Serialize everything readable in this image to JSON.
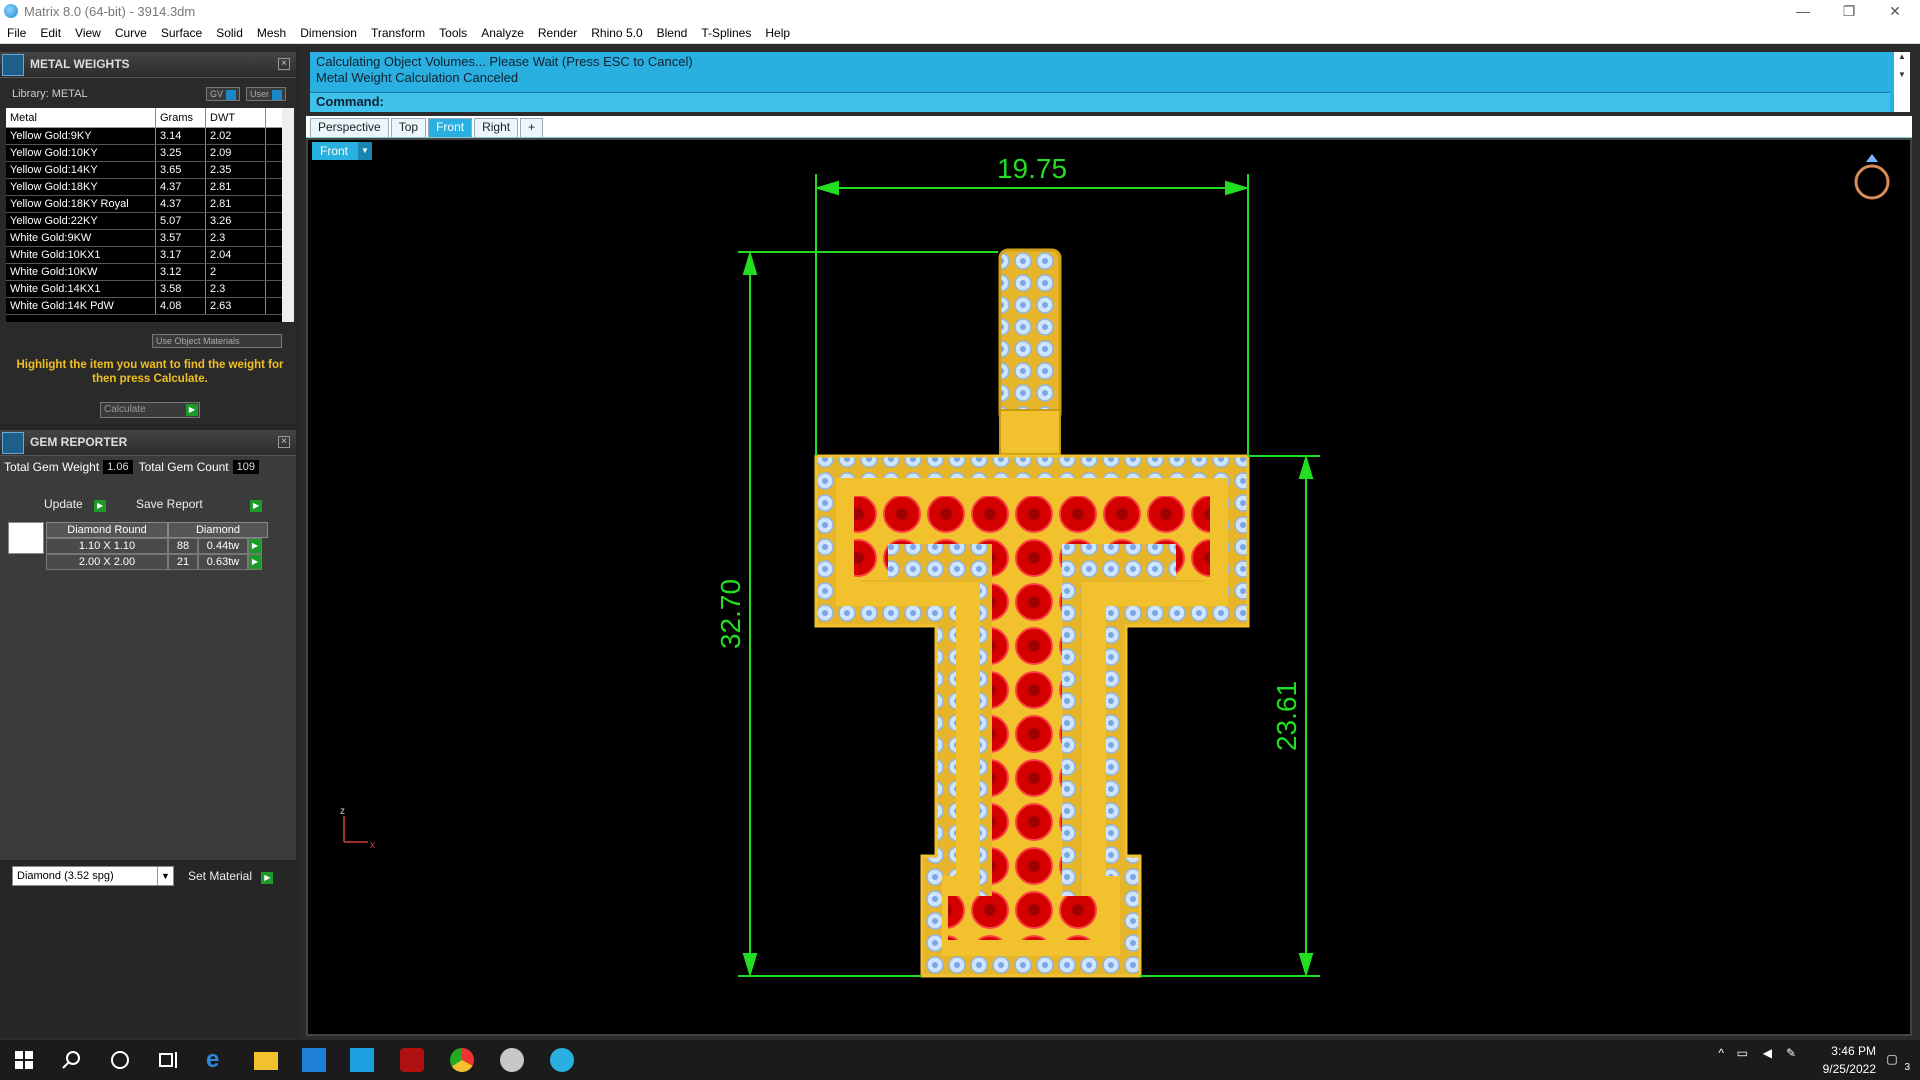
{
  "window": {
    "title": "Matrix 8.0 (64-bit) - 3914.3dm",
    "minimize": "—",
    "restore": "❐",
    "close": "✕"
  },
  "menu": [
    "File",
    "Edit",
    "View",
    "Curve",
    "Surface",
    "Solid",
    "Mesh",
    "Dimension",
    "Transform",
    "Tools",
    "Analyze",
    "Render",
    "Rhino 5.0",
    "Blend",
    "T-Splines",
    "Help"
  ],
  "metal_weights": {
    "title": "METAL WEIGHTS",
    "library_label": "Library: METAL",
    "gv_btn": "GV",
    "user_btn": "User",
    "columns": [
      "Metal",
      "Grams",
      "DWT"
    ],
    "rows": [
      [
        "Yellow Gold:9KY",
        "3.14",
        "2.02"
      ],
      [
        "Yellow Gold:10KY",
        "3.25",
        "2.09"
      ],
      [
        "Yellow Gold:14KY",
        "3.65",
        "2.35"
      ],
      [
        "Yellow Gold:18KY",
        "4.37",
        "2.81"
      ],
      [
        "Yellow Gold:18KY Royal",
        "4.37",
        "2.81"
      ],
      [
        "Yellow Gold:22KY",
        "5.07",
        "3.26"
      ],
      [
        "White Gold:9KW",
        "3.57",
        "2.3"
      ],
      [
        "White Gold:10KX1",
        "3.17",
        "2.04"
      ],
      [
        "White Gold:10KW",
        "3.12",
        "2"
      ],
      [
        "White Gold:14KX1",
        "3.58",
        "2.3"
      ],
      [
        "White Gold:14K PdW",
        "4.08",
        "2.63"
      ]
    ],
    "use_object_materials": "Use Object Materials",
    "hint": "Highlight the item you want to find the weight for then press Calculate.",
    "calculate": "Calculate"
  },
  "gem_reporter": {
    "title": "GEM REPORTER",
    "total_weight_label": "Total Gem Weight",
    "total_weight": "1.06",
    "total_count_label": "Total Gem Count",
    "total_count": "109",
    "update": "Update",
    "save_report": "Save Report",
    "gem_cut": "Diamond Round",
    "gem_type": "Diamond",
    "rows": [
      [
        "1.10 X 1.10",
        "88",
        "0.44tw"
      ],
      [
        "2.00 X 2.00",
        "21",
        "0.63tw"
      ]
    ],
    "material_select": "Diamond     (3.52 spg)",
    "set_material": "Set Material"
  },
  "command": {
    "line1": "Calculating Object Volumes... Please Wait (Press ESC to Cancel)",
    "line2": "Metal Weight Calculation Canceled",
    "prompt": "Command:"
  },
  "viewport_tabs": [
    "Perspective",
    "Top",
    "Front",
    "Right"
  ],
  "active_tab": "Front",
  "viewport_label": "Front",
  "dimensions": {
    "width": "19.75",
    "height_total": "32.70",
    "height_lower": "23.61"
  },
  "axis": {
    "z": "z",
    "x": "x"
  },
  "taskbar": {
    "time": "3:46 PM",
    "date": "9/25/2022",
    "notif_count": "3"
  },
  "colors": {
    "accent": "#2ab0e0",
    "dimension": "#22dd22",
    "gold": "#f2c12e",
    "ruby": "#d40000",
    "diamond": "#cfe4ff"
  }
}
